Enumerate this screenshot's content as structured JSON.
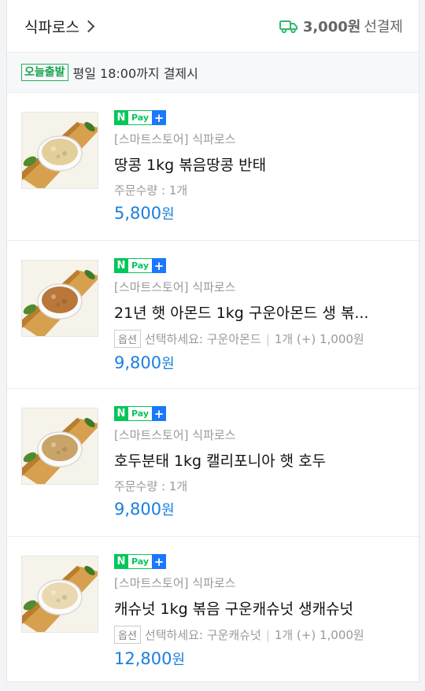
{
  "store": {
    "name": "식파로스",
    "shipping_amount": "3,000원",
    "shipping_label": "선결제"
  },
  "dispatch": {
    "badge": "오늘출발",
    "text": "평일 18:00까지 결제시"
  },
  "npay": {
    "n": "N",
    "pay": "Pay",
    "plus": "+"
  },
  "option_badge": "옵션",
  "items": [
    {
      "seller": "[스마트스토어] 식파로스",
      "name": "땅콩 1kg 볶음땅콩 반태",
      "meta_type": "qty",
      "qty": "주문수량 : 1개",
      "option": "",
      "option_qty": "",
      "price": "5,800",
      "unit": "원",
      "nut_color": "#e3cf9a"
    },
    {
      "seller": "[스마트스토어] 식파로스",
      "name": "21년 햇 아몬드 1kg 구운아몬드 생 볶...",
      "meta_type": "option",
      "qty": "",
      "option": "선택하세요: 구운아몬드",
      "option_qty": "1개 (+) 1,000원",
      "price": "9,800",
      "unit": "원",
      "nut_color": "#b9773a"
    },
    {
      "seller": "[스마트스토어] 식파로스",
      "name": "호두분태 1kg 캘리포니아 햇 호두",
      "meta_type": "qty",
      "qty": "주문수량 : 1개",
      "option": "",
      "option_qty": "",
      "price": "9,800",
      "unit": "원",
      "nut_color": "#c9a468"
    },
    {
      "seller": "[스마트스토어] 식파로스",
      "name": "캐슈넛 1kg 볶음 구운캐슈넛 생캐슈넛",
      "meta_type": "option",
      "qty": "",
      "option": "선택하세요: 구운캐슈넛",
      "option_qty": "1개 (+) 1,000원",
      "price": "12,800",
      "unit": "원",
      "nut_color": "#ead9b0"
    }
  ]
}
